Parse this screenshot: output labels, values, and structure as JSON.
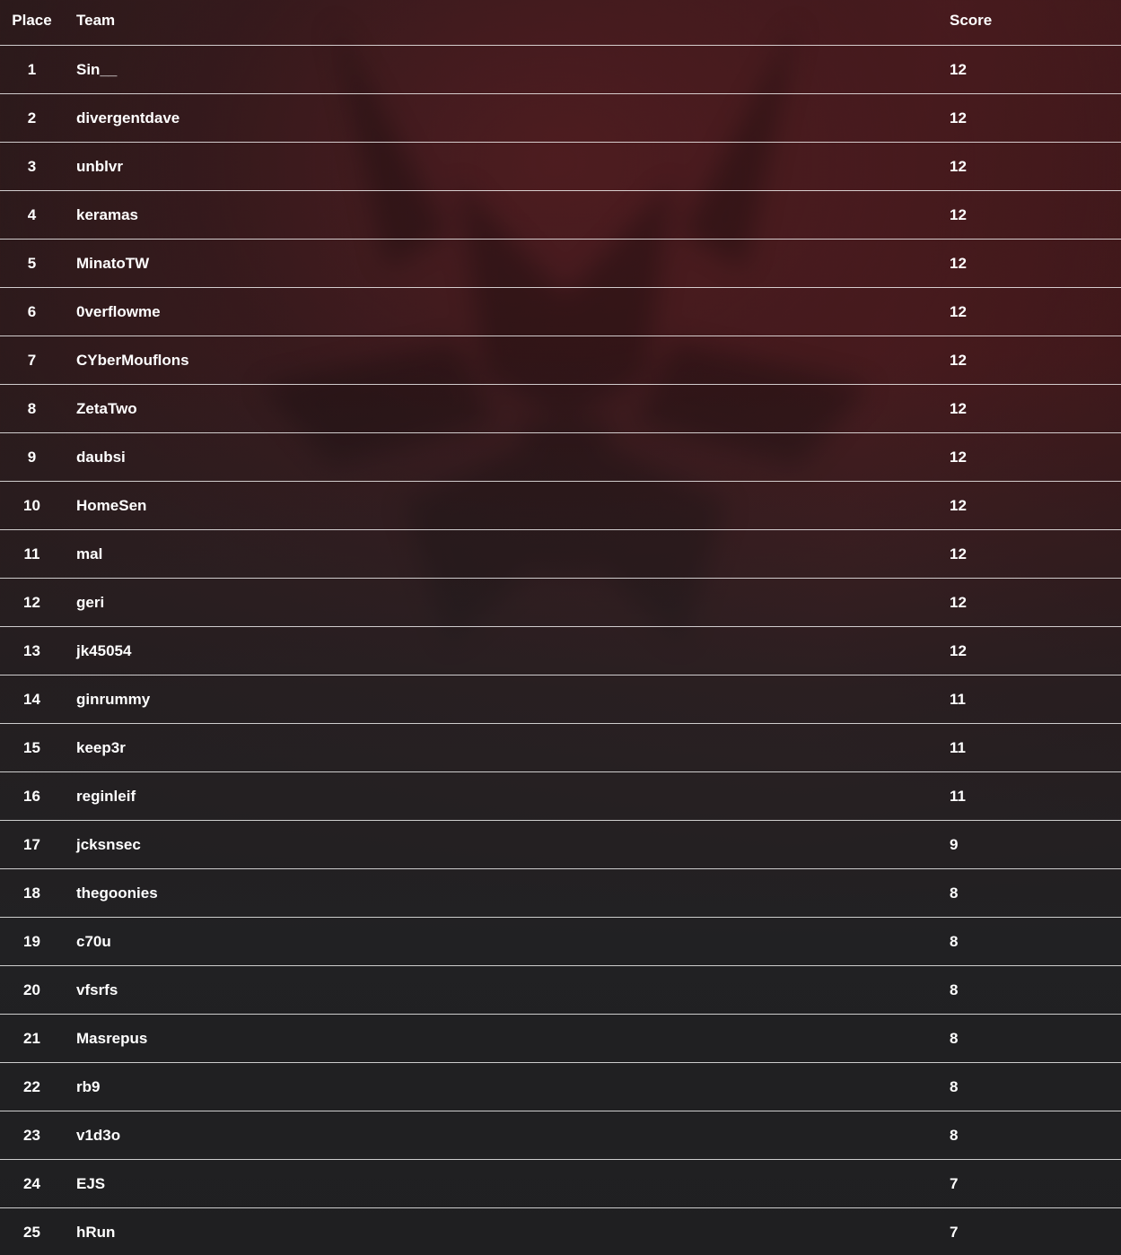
{
  "header": {
    "place": "Place",
    "team": "Team",
    "score": "Score"
  },
  "rows": [
    {
      "place": "1",
      "team": "Sin__",
      "score": "12"
    },
    {
      "place": "2",
      "team": "divergentdave",
      "score": "12"
    },
    {
      "place": "3",
      "team": "unblvr",
      "score": "12"
    },
    {
      "place": "4",
      "team": "keramas",
      "score": "12"
    },
    {
      "place": "5",
      "team": "MinatoTW",
      "score": "12"
    },
    {
      "place": "6",
      "team": "0verflowme",
      "score": "12"
    },
    {
      "place": "7",
      "team": "CYberMouflons",
      "score": "12"
    },
    {
      "place": "8",
      "team": "ZetaTwo",
      "score": "12"
    },
    {
      "place": "9",
      "team": "daubsi",
      "score": "12"
    },
    {
      "place": "10",
      "team": "HomeSen",
      "score": "12"
    },
    {
      "place": "11",
      "team": "mal",
      "score": "12"
    },
    {
      "place": "12",
      "team": "geri",
      "score": "12"
    },
    {
      "place": "13",
      "team": "jk45054",
      "score": "12"
    },
    {
      "place": "14",
      "team": "ginrummy",
      "score": "11"
    },
    {
      "place": "15",
      "team": "keep3r",
      "score": "11"
    },
    {
      "place": "16",
      "team": "reginleif",
      "score": "11"
    },
    {
      "place": "17",
      "team": "jcksnsec",
      "score": "9"
    },
    {
      "place": "18",
      "team": "thegoonies",
      "score": "8"
    },
    {
      "place": "19",
      "team": "c70u",
      "score": "8"
    },
    {
      "place": "20",
      "team": "vfsrfs",
      "score": "8"
    },
    {
      "place": "21",
      "team": "Masrepus",
      "score": "8"
    },
    {
      "place": "22",
      "team": "rb9",
      "score": "8"
    },
    {
      "place": "23",
      "team": "v1d3o",
      "score": "8"
    },
    {
      "place": "24",
      "team": "EJS",
      "score": "7"
    },
    {
      "place": "25",
      "team": "hRun",
      "score": "7"
    }
  ]
}
